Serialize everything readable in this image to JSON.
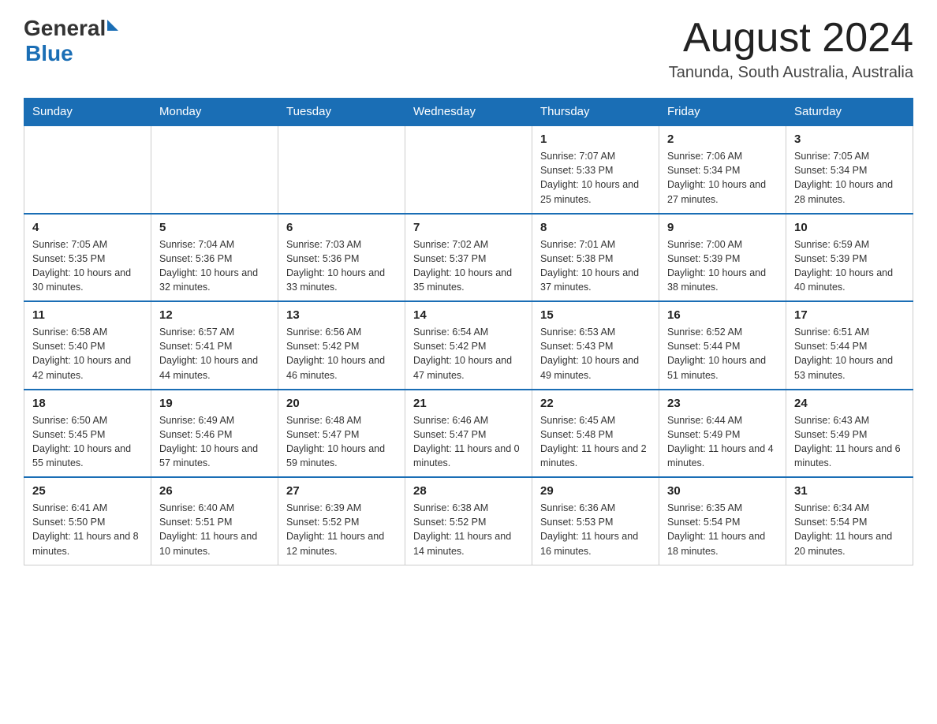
{
  "header": {
    "logo_general": "General",
    "logo_blue": "Blue",
    "month_year": "August 2024",
    "location": "Tanunda, South Australia, Australia"
  },
  "calendar": {
    "days_of_week": [
      "Sunday",
      "Monday",
      "Tuesday",
      "Wednesday",
      "Thursday",
      "Friday",
      "Saturday"
    ],
    "weeks": [
      [
        {
          "day": "",
          "info": ""
        },
        {
          "day": "",
          "info": ""
        },
        {
          "day": "",
          "info": ""
        },
        {
          "day": "",
          "info": ""
        },
        {
          "day": "1",
          "info": "Sunrise: 7:07 AM\nSunset: 5:33 PM\nDaylight: 10 hours\nand 25 minutes."
        },
        {
          "day": "2",
          "info": "Sunrise: 7:06 AM\nSunset: 5:34 PM\nDaylight: 10 hours\nand 27 minutes."
        },
        {
          "day": "3",
          "info": "Sunrise: 7:05 AM\nSunset: 5:34 PM\nDaylight: 10 hours\nand 28 minutes."
        }
      ],
      [
        {
          "day": "4",
          "info": "Sunrise: 7:05 AM\nSunset: 5:35 PM\nDaylight: 10 hours\nand 30 minutes."
        },
        {
          "day": "5",
          "info": "Sunrise: 7:04 AM\nSunset: 5:36 PM\nDaylight: 10 hours\nand 32 minutes."
        },
        {
          "day": "6",
          "info": "Sunrise: 7:03 AM\nSunset: 5:36 PM\nDaylight: 10 hours\nand 33 minutes."
        },
        {
          "day": "7",
          "info": "Sunrise: 7:02 AM\nSunset: 5:37 PM\nDaylight: 10 hours\nand 35 minutes."
        },
        {
          "day": "8",
          "info": "Sunrise: 7:01 AM\nSunset: 5:38 PM\nDaylight: 10 hours\nand 37 minutes."
        },
        {
          "day": "9",
          "info": "Sunrise: 7:00 AM\nSunset: 5:39 PM\nDaylight: 10 hours\nand 38 minutes."
        },
        {
          "day": "10",
          "info": "Sunrise: 6:59 AM\nSunset: 5:39 PM\nDaylight: 10 hours\nand 40 minutes."
        }
      ],
      [
        {
          "day": "11",
          "info": "Sunrise: 6:58 AM\nSunset: 5:40 PM\nDaylight: 10 hours\nand 42 minutes."
        },
        {
          "day": "12",
          "info": "Sunrise: 6:57 AM\nSunset: 5:41 PM\nDaylight: 10 hours\nand 44 minutes."
        },
        {
          "day": "13",
          "info": "Sunrise: 6:56 AM\nSunset: 5:42 PM\nDaylight: 10 hours\nand 46 minutes."
        },
        {
          "day": "14",
          "info": "Sunrise: 6:54 AM\nSunset: 5:42 PM\nDaylight: 10 hours\nand 47 minutes."
        },
        {
          "day": "15",
          "info": "Sunrise: 6:53 AM\nSunset: 5:43 PM\nDaylight: 10 hours\nand 49 minutes."
        },
        {
          "day": "16",
          "info": "Sunrise: 6:52 AM\nSunset: 5:44 PM\nDaylight: 10 hours\nand 51 minutes."
        },
        {
          "day": "17",
          "info": "Sunrise: 6:51 AM\nSunset: 5:44 PM\nDaylight: 10 hours\nand 53 minutes."
        }
      ],
      [
        {
          "day": "18",
          "info": "Sunrise: 6:50 AM\nSunset: 5:45 PM\nDaylight: 10 hours\nand 55 minutes."
        },
        {
          "day": "19",
          "info": "Sunrise: 6:49 AM\nSunset: 5:46 PM\nDaylight: 10 hours\nand 57 minutes."
        },
        {
          "day": "20",
          "info": "Sunrise: 6:48 AM\nSunset: 5:47 PM\nDaylight: 10 hours\nand 59 minutes."
        },
        {
          "day": "21",
          "info": "Sunrise: 6:46 AM\nSunset: 5:47 PM\nDaylight: 11 hours\nand 0 minutes."
        },
        {
          "day": "22",
          "info": "Sunrise: 6:45 AM\nSunset: 5:48 PM\nDaylight: 11 hours\nand 2 minutes."
        },
        {
          "day": "23",
          "info": "Sunrise: 6:44 AM\nSunset: 5:49 PM\nDaylight: 11 hours\nand 4 minutes."
        },
        {
          "day": "24",
          "info": "Sunrise: 6:43 AM\nSunset: 5:49 PM\nDaylight: 11 hours\nand 6 minutes."
        }
      ],
      [
        {
          "day": "25",
          "info": "Sunrise: 6:41 AM\nSunset: 5:50 PM\nDaylight: 11 hours\nand 8 minutes."
        },
        {
          "day": "26",
          "info": "Sunrise: 6:40 AM\nSunset: 5:51 PM\nDaylight: 11 hours\nand 10 minutes."
        },
        {
          "day": "27",
          "info": "Sunrise: 6:39 AM\nSunset: 5:52 PM\nDaylight: 11 hours\nand 12 minutes."
        },
        {
          "day": "28",
          "info": "Sunrise: 6:38 AM\nSunset: 5:52 PM\nDaylight: 11 hours\nand 14 minutes."
        },
        {
          "day": "29",
          "info": "Sunrise: 6:36 AM\nSunset: 5:53 PM\nDaylight: 11 hours\nand 16 minutes."
        },
        {
          "day": "30",
          "info": "Sunrise: 6:35 AM\nSunset: 5:54 PM\nDaylight: 11 hours\nand 18 minutes."
        },
        {
          "day": "31",
          "info": "Sunrise: 6:34 AM\nSunset: 5:54 PM\nDaylight: 11 hours\nand 20 minutes."
        }
      ]
    ]
  }
}
